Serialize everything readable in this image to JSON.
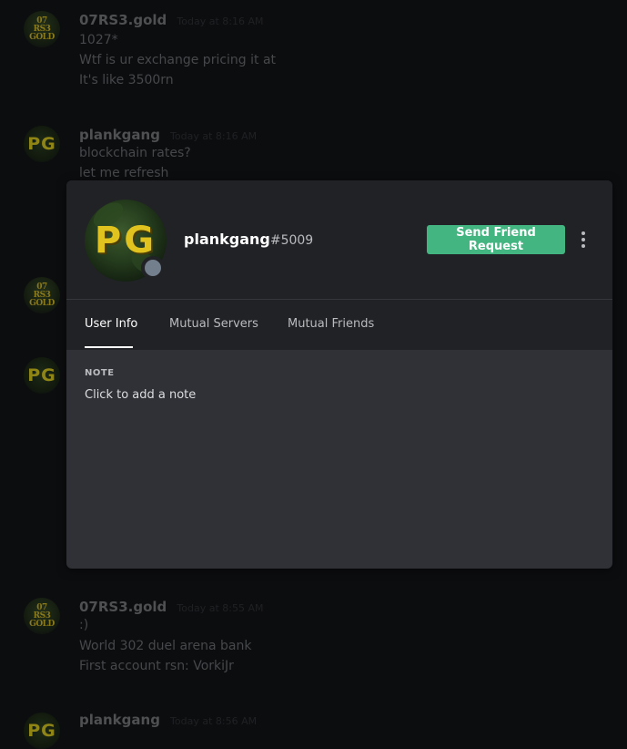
{
  "chat": {
    "messages": [
      {
        "author": "07RS3.gold",
        "timestamp": "Today at 8:16 AM",
        "avatar_line1": "07",
        "avatar_line2": "RS3",
        "avatar_line3": "GOLD",
        "lines": [
          "1027*",
          "Wtf is ur exchange pricing it at",
          "It's like 3500rn"
        ]
      },
      {
        "author": "plankgang",
        "timestamp": "Today at 8:16 AM",
        "avatar_text": "PG",
        "lines": [
          "blockchain rates?",
          "let me refresh"
        ]
      },
      {
        "author": "07RS3.gold",
        "timestamp": "Today at 8:55 AM",
        "avatar_line1": "07",
        "avatar_line2": "RS3",
        "avatar_line3": "GOLD",
        "lines": [
          ":)",
          "World 302 duel arena bank",
          "First account rsn: VorkiJr"
        ]
      },
      {
        "author": "plankgang",
        "timestamp": "Today at 8:56 AM",
        "avatar_text": "PG",
        "lines": []
      }
    ],
    "partial_avatars": [
      {
        "kind": "gold",
        "line1": "07",
        "line2": "RS3",
        "line3": "GOLD"
      },
      {
        "kind": "pg",
        "text": "PG"
      }
    ]
  },
  "profile": {
    "avatar_text": "PG",
    "username": "plankgang",
    "discriminator": "#5009",
    "status_color": "#747f8d",
    "send_friend_request_label": "Send Friend Request",
    "more_icon": "more-vertical-icon",
    "tabs": [
      {
        "label": "User Info",
        "active": true
      },
      {
        "label": "Mutual Servers",
        "active": false
      },
      {
        "label": "Mutual Friends",
        "active": false
      }
    ],
    "note_label": "NOTE",
    "note_placeholder": "Click to add a note"
  },
  "colors": {
    "accent_green": "#43b581",
    "modal_bg": "#2f3136",
    "header_bg": "#202225",
    "backdrop": "#0c0d0f"
  }
}
